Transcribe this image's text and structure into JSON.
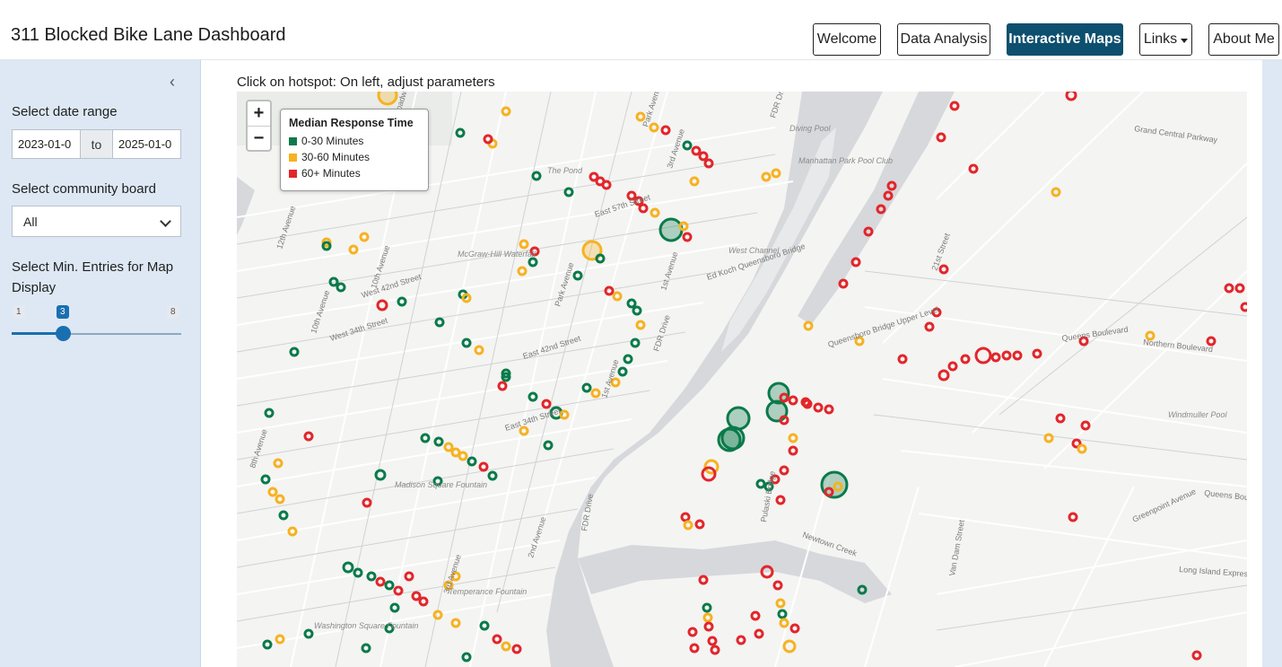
{
  "app": {
    "title": "311 Blocked Bike Lane Dashboard"
  },
  "nav": {
    "welcome": "Welcome",
    "data_analysis": "Data Analysis",
    "interactive_maps": "Interactive Maps",
    "links": "Links",
    "about_me": "About Me"
  },
  "sidebar": {
    "collapse_icon": "chevron-left-icon",
    "date_label": "Select date range",
    "date_start": "2023-01-0",
    "date_sep": "to",
    "date_end": "2025-01-0",
    "board_label": "Select community board",
    "board_value": "All",
    "entries_label": "Select Min. Entries for Map Display",
    "slider": {
      "min": "1",
      "value": "3",
      "max": "8"
    }
  },
  "main": {
    "hint": "Click on hotspot: On left, adjust parameters"
  },
  "map": {
    "zoom_in": "+",
    "zoom_out": "−",
    "legend": {
      "title": "Median Response Time",
      "items": [
        {
          "label": "0-30 Minutes",
          "color": "#0a7a4a"
        },
        {
          "label": "30-60 Minutes",
          "color": "#f6b221"
        },
        {
          "label": "60+ Minutes",
          "color": "#e2262b"
        }
      ]
    },
    "place_labels": [
      "Broadway",
      "The Pond",
      "Diving Pool",
      "Manhattan Park Pool Club",
      "Grand Central Parkway",
      "FDR Drive",
      "East 57th Street",
      "McGraw-Hill Waterfall",
      "West 42nd Street",
      "West Channel",
      "Ed Koch Queensboro Bridge",
      "Queensboro Bridge Upper Level",
      "21st Street",
      "West 34th Street",
      "East 42nd Street",
      "East 34th Street",
      "Madison Square Fountain",
      "Queens Boulevard",
      "Windmuller Pool",
      "Northern Boulevard",
      "Pulaski Bridge",
      "Newtown Creek",
      "Greenpoint Avenue",
      "Long Island Expressway",
      "Temperance Fountain",
      "Washington Square Fountain",
      "12th Avenue",
      "10th Avenue",
      "8th Avenue",
      "Park Avenue",
      "1st Avenue",
      "3rd Avenue",
      "2nd Avenue",
      "Van Dam Street",
      "Queens Boule"
    ]
  }
}
